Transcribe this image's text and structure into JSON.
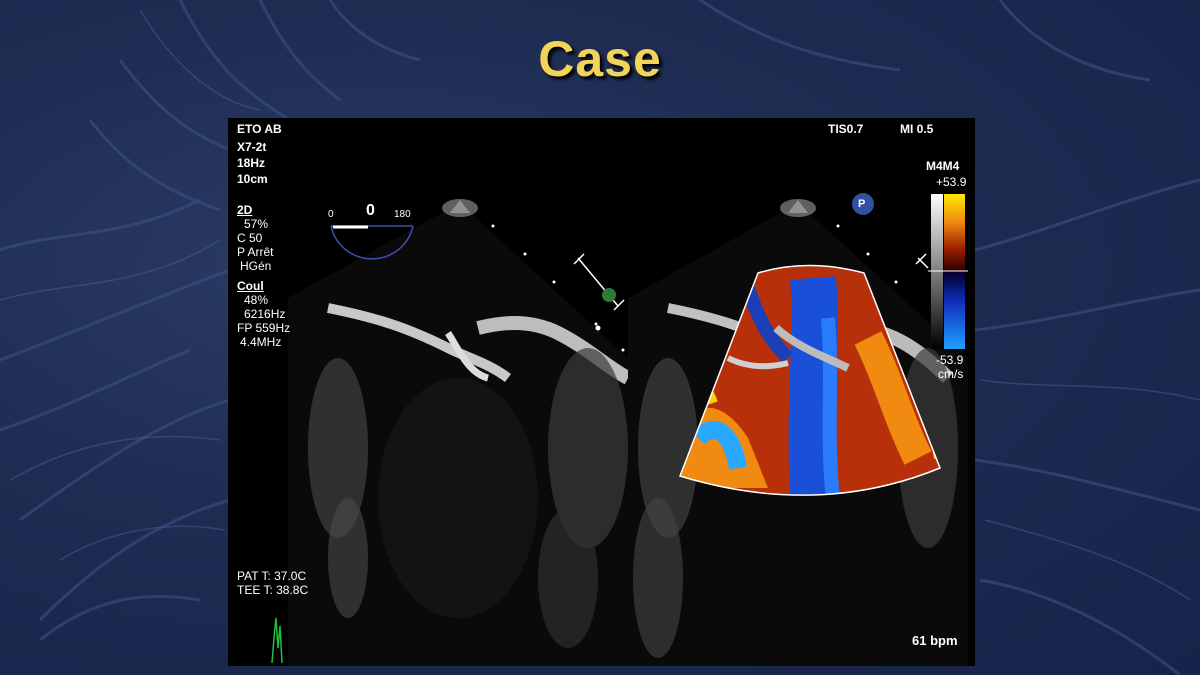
{
  "slide": {
    "title": "Case"
  },
  "echo": {
    "header": {
      "mode": "ETO AB",
      "probe": "X7-2t",
      "frame_rate": "18Hz",
      "depth": "10cm",
      "tis": "TIS0.7",
      "mi": "MI 0.5"
    },
    "settings_2d": {
      "label": "2D",
      "gain": "57%",
      "compression": "C 50",
      "persistence": "P Arrêt",
      "frequency": "HGén"
    },
    "settings_color": {
      "label": "Coul",
      "gain": "48%",
      "prf": "6216Hz",
      "filter": "FP 559Hz",
      "frequency": "4.4MHz"
    },
    "angle": {
      "min": "0",
      "value": "0",
      "max": "180"
    },
    "color_scale": {
      "map": "M4M4",
      "max": "+53.9",
      "min": "-53.9",
      "unit": "cm/s"
    },
    "marker_p": "P",
    "temperatures": {
      "patient": "PAT T: 37.0C",
      "tee": "TEE T: 38.8C"
    },
    "heart_rate": "61 bpm",
    "colors": {
      "doppler_red": "#b8300a",
      "doppler_blue": "#1a4fd8",
      "doppler_orange": "#f08a10",
      "title_yellow": "#f2d45a"
    }
  }
}
